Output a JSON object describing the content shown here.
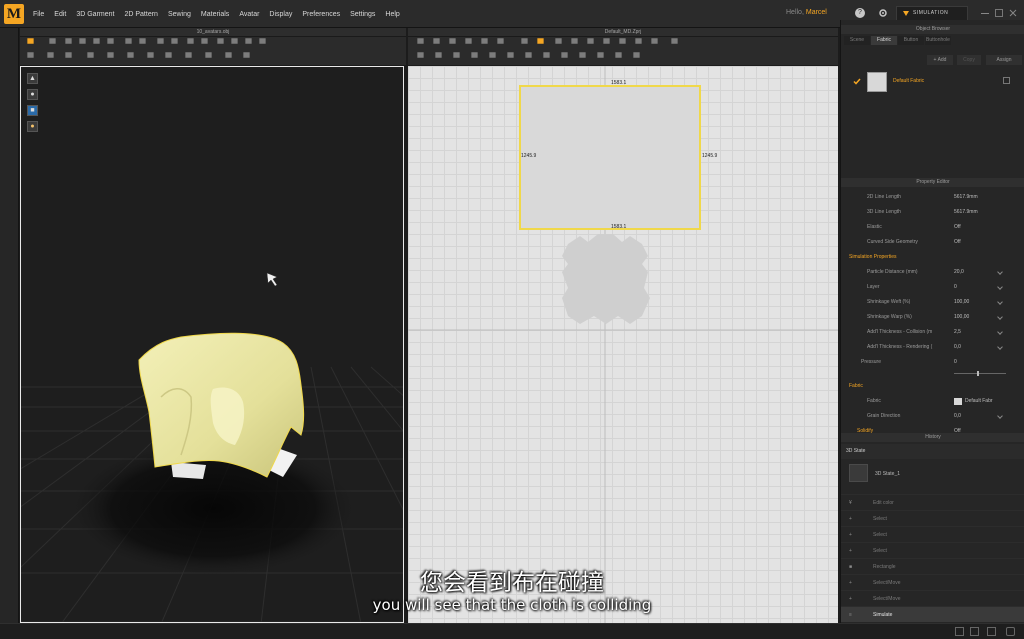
{
  "app": {
    "logo": "M"
  },
  "menu": [
    "File",
    "Edit",
    "3D Garment",
    "2D Pattern",
    "Sewing",
    "Materials",
    "Avatar",
    "Display",
    "Preferences",
    "Settings",
    "Help"
  ],
  "user": {
    "greeting": "Hello,",
    "name": "Marcel"
  },
  "mode_button": "SIMULATION",
  "viewport3d": {
    "title": "10_avatars.obj"
  },
  "viewport2d": {
    "title": "Default_MD.Zprj",
    "pattern": {
      "top": "1583.1",
      "bottom": "1583.1",
      "left": "1245.9",
      "right": "1245.9"
    }
  },
  "object_browser": {
    "title": "Object Browser",
    "tabs": [
      "Scene",
      "Fabric",
      "Button",
      "Buttonhole"
    ],
    "active_tab": "Fabric",
    "buttons": {
      "add": "+ Add",
      "copy": "Copy",
      "assign": "Assign"
    },
    "fabric_name": "Default Fabric"
  },
  "property_editor": {
    "title": "Property Editor",
    "rows_top": [
      {
        "label": "2D Line Length",
        "value": "5617.9mm"
      },
      {
        "label": "3D Line Length",
        "value": "5617.9mm"
      },
      {
        "label": "Elastic",
        "value": "Off"
      },
      {
        "label": "Curved Side Geometry",
        "value": "Off"
      }
    ],
    "sim_section": "Simulation Properties",
    "sim_rows": [
      {
        "label": "Particle Distance (mm)",
        "value": "20,0"
      },
      {
        "label": "Layer",
        "value": "0"
      },
      {
        "label": "Shrinkage Weft (%)",
        "value": "100,00"
      },
      {
        "label": "Shrinkage Warp (%)",
        "value": "100,00"
      },
      {
        "label": "Add'l Thickness - Collision (m",
        "value": "2,5"
      },
      {
        "label": "Add'l Thickness - Rendering (",
        "value": "0,0"
      }
    ],
    "pressure": {
      "label": "Pressure",
      "value": "0"
    },
    "fabric_section": "Fabric",
    "fabric_rows": [
      {
        "label": "Fabric",
        "value": "Default Fabr"
      },
      {
        "label": "Grain Direction",
        "value": "0,0"
      }
    ],
    "solidify": {
      "label": "Solidify",
      "value": "Off"
    }
  },
  "history": {
    "title": "History",
    "header": "3D State",
    "state_label": "3D State_1",
    "items": [
      "Edit color",
      "Select",
      "Select",
      "Select",
      "Rectangle",
      "Select/Move",
      "Select/Move",
      "Simulate"
    ]
  },
  "subtitles": {
    "zh": "您会看到布在碰撞",
    "en": "you will see that the cloth is colliding"
  },
  "colors": {
    "accent": "#f5a623",
    "pattern_outline": "#f0d84a",
    "cloth": "#ece9a6"
  }
}
